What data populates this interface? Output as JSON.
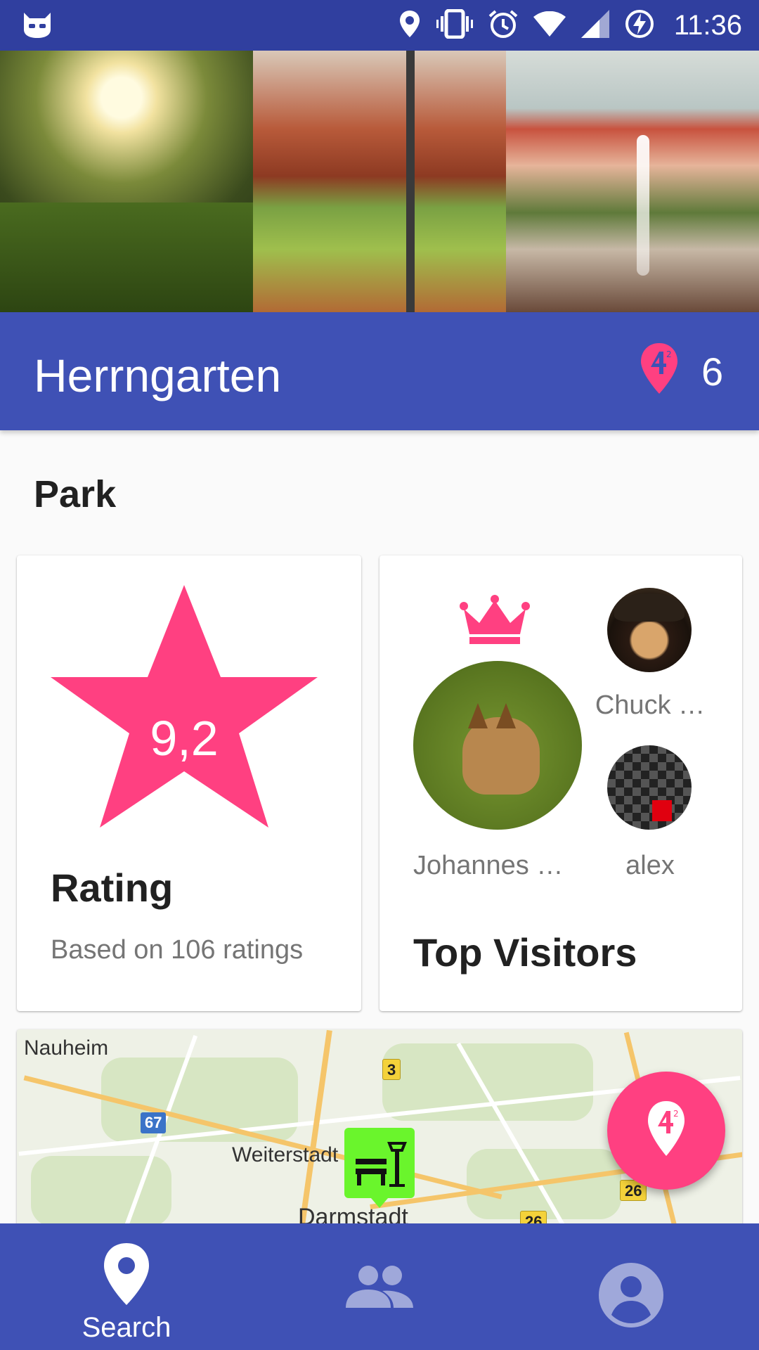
{
  "status_bar": {
    "time": "11:36",
    "icons": [
      "cyanogen-icon",
      "location-icon",
      "vibrate-icon",
      "alarm-icon",
      "wifi-icon",
      "signal-icon",
      "battery-charging-icon"
    ]
  },
  "header": {
    "photos": [
      "park-sunset-photo",
      "autumn-tree-photo",
      "palace-fountain-photo"
    ],
    "title": "Herrngarten",
    "checkins_icon": "foursquared-pin-icon",
    "checkins_count": "6"
  },
  "category": "Park",
  "rating_card": {
    "value": "9,2",
    "label": "Rating",
    "subtitle": "Based on 106 ratings"
  },
  "visitors_card": {
    "label": "Top Visitors",
    "visitors": [
      {
        "name": "Johannes …",
        "rank": "top",
        "badge_icon": "crown-icon"
      },
      {
        "name": "Chuck …"
      },
      {
        "name": "alex"
      }
    ]
  },
  "map": {
    "labels": [
      "Nauheim",
      "Weiterstadt",
      "Darmstadt"
    ],
    "shields": [
      "67",
      "3",
      "26",
      "26"
    ]
  },
  "fab": {
    "icon": "foursquared-pin-icon"
  },
  "bottom_nav": {
    "items": [
      {
        "label": "Search",
        "icon": "location-pin-icon",
        "active": true
      },
      {
        "label": "",
        "icon": "people-icon",
        "active": false
      },
      {
        "label": "",
        "icon": "account-circle-icon",
        "active": false
      }
    ]
  },
  "colors": {
    "primary": "#3f51b5",
    "primary_dark": "#303f9f",
    "accent": "#ff4081",
    "marker_green": "#6af52c"
  }
}
